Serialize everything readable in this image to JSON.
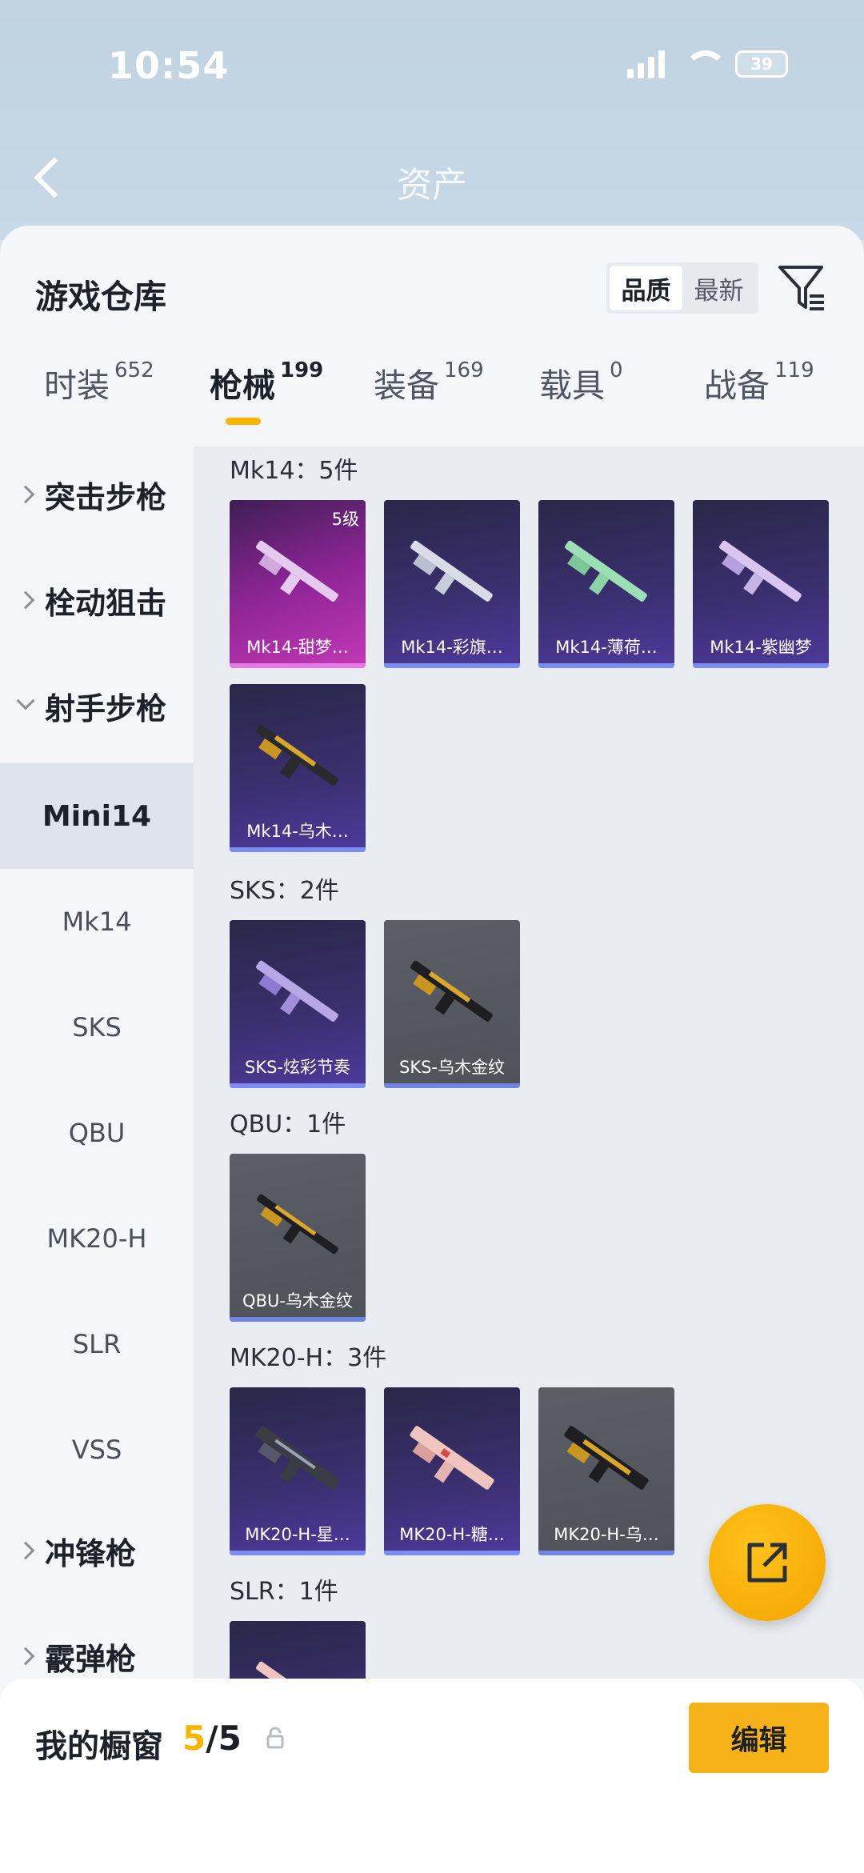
{
  "status": {
    "time": "10:54",
    "battery": "39"
  },
  "header": {
    "title": "资产"
  },
  "sheet": {
    "title": "游戏仓库"
  },
  "sort": {
    "options": [
      "品质",
      "最新"
    ],
    "active": 0
  },
  "tabs": [
    {
      "label": "时装",
      "count": "652"
    },
    {
      "label": "枪械",
      "count": "199",
      "active": true
    },
    {
      "label": "装备",
      "count": "169"
    },
    {
      "label": "载具",
      "count": "0"
    },
    {
      "label": "战备",
      "count": "119"
    }
  ],
  "sidebar": {
    "categories": {
      "assault": "突击步枪",
      "bolt": "栓动狙击",
      "dmr": "射手步枪",
      "smg": "冲锋枪",
      "shotgun": "霰弹枪"
    },
    "sub": [
      "Mini14",
      "Mk14",
      "SKS",
      "QBU",
      "MK20-H",
      "SLR",
      "VSS"
    ]
  },
  "groups": {
    "mk14": {
      "title": "Mk14：5件",
      "items": [
        {
          "name": "Mk14-甜梦…",
          "level": "5级"
        },
        {
          "name": "Mk14-彩旗…"
        },
        {
          "name": "Mk14-薄荷…"
        },
        {
          "name": "Mk14-紫幽梦"
        },
        {
          "name": "Mk14-乌木…"
        }
      ]
    },
    "sks": {
      "title": "SKS：2件",
      "items": [
        {
          "name": "SKS-炫彩节奏"
        },
        {
          "name": "SKS-乌木金纹"
        }
      ]
    },
    "qbu": {
      "title": "QBU：1件",
      "items": [
        {
          "name": "QBU-乌木金纹"
        }
      ]
    },
    "mk20": {
      "title": "MK20-H：3件",
      "items": [
        {
          "name": "MK20-H-星…"
        },
        {
          "name": "MK20-H-糖…"
        },
        {
          "name": "MK20-H-乌…"
        }
      ]
    },
    "slr": {
      "title": "SLR：1件"
    }
  },
  "showcase": {
    "title": "我的橱窗",
    "current": "5",
    "total": "/5",
    "edit_label": "编辑"
  },
  "colors": {
    "accent": "#f7b500",
    "purple_tile": "#3a2f6e",
    "pink_tile": "#c339b6",
    "grey_tile": "#55575f"
  }
}
